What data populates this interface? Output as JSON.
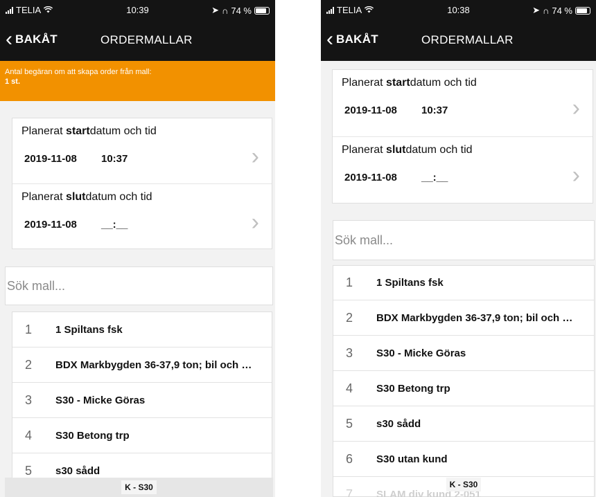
{
  "left": {
    "status": {
      "carrier": "TELIA",
      "time": "10:39",
      "battery": "74 %"
    },
    "nav": {
      "back_label": "BAKÅT",
      "title": "ORDERMALLAR"
    },
    "banner": {
      "line1": "Antal begäran om att skapa order från mall:",
      "line2": "1 st."
    },
    "start": {
      "label_pre": "Planerat ",
      "label_bold": "start",
      "label_post": "datum och tid",
      "date": "2019-11-08",
      "time": "10:37"
    },
    "end": {
      "label_pre": "Planerat ",
      "label_bold": "slut",
      "label_post": "datum och tid",
      "date": "2019-11-08",
      "time": "__:__"
    },
    "search": {
      "placeholder": "Sök mall..."
    },
    "items": [
      {
        "num": "1",
        "name": "1 Spiltans fsk"
      },
      {
        "num": "2",
        "name": "BDX Markbygden 36-37,9 ton; bil och …"
      },
      {
        "num": "3",
        "name": "S30 - Micke Göras"
      },
      {
        "num": "4",
        "name": "S30 Betong trp"
      },
      {
        "num": "5",
        "name": "s30 sådd"
      }
    ],
    "tab": "K - S30"
  },
  "right": {
    "status": {
      "carrier": "TELIA",
      "time": "10:38",
      "battery": "74 %"
    },
    "nav": {
      "back_label": "BAKÅT",
      "title": "ORDERMALLAR"
    },
    "start": {
      "label_pre": "Planerat ",
      "label_bold": "start",
      "label_post": "datum och tid",
      "date": "2019-11-08",
      "time": "10:37"
    },
    "end": {
      "label_pre": "Planerat ",
      "label_bold": "slut",
      "label_post": "datum och tid",
      "date": "2019-11-08",
      "time": "__:__"
    },
    "search": {
      "placeholder": "Sök mall..."
    },
    "items": [
      {
        "num": "1",
        "name": "1 Spiltans fsk"
      },
      {
        "num": "2",
        "name": "BDX Markbygden 36-37,9 ton; bil och …"
      },
      {
        "num": "3",
        "name": "S30 - Micke Göras"
      },
      {
        "num": "4",
        "name": "S30 Betong trp"
      },
      {
        "num": "5",
        "name": "s30 sådd"
      },
      {
        "num": "6",
        "name": "S30 utan kund"
      },
      {
        "num": "7",
        "name": "SLAM div kund 2-051"
      }
    ],
    "tab": "K - S30"
  },
  "colors": {
    "nav_bg": "#141414",
    "banner_bg": "#f29100",
    "page_bg": "#f2f2f2"
  },
  "icons": {
    "back": "chevron-left-icon",
    "row_arrow": "chevron-right-icon",
    "signal": "signal-bars-icon",
    "wifi": "wifi-icon",
    "battery": "battery-icon"
  }
}
